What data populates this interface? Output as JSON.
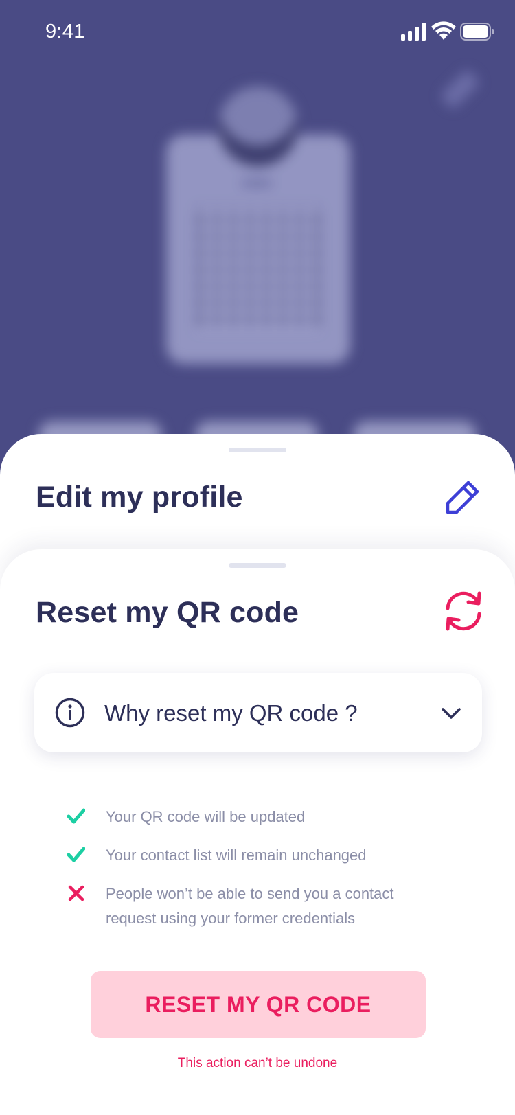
{
  "status_bar": {
    "time": "9:41"
  },
  "edit_sheet": {
    "title": "Edit my profile",
    "icon": "pencil-icon",
    "accent": "#3d3fd6"
  },
  "reset_sheet": {
    "title": "Reset my QR code",
    "icon": "refresh-icon",
    "accent": "#ea1e5f",
    "accordion": {
      "label": "Why reset my QR code ?",
      "icon": "info-icon",
      "toggle_icon": "chevron-down-icon"
    },
    "items": [
      {
        "status": "check",
        "text": "Your QR code will be updated",
        "color": "#1ccfa3"
      },
      {
        "status": "check",
        "text": "Your contact list will remain unchanged",
        "color": "#1ccfa3"
      },
      {
        "status": "cross",
        "text": "People won’t be able to send you a contact request using your former credentials",
        "color": "#ea1e5f"
      }
    ],
    "button_label": "RESET MY QR CODE",
    "note": "This action can’t be undone"
  }
}
